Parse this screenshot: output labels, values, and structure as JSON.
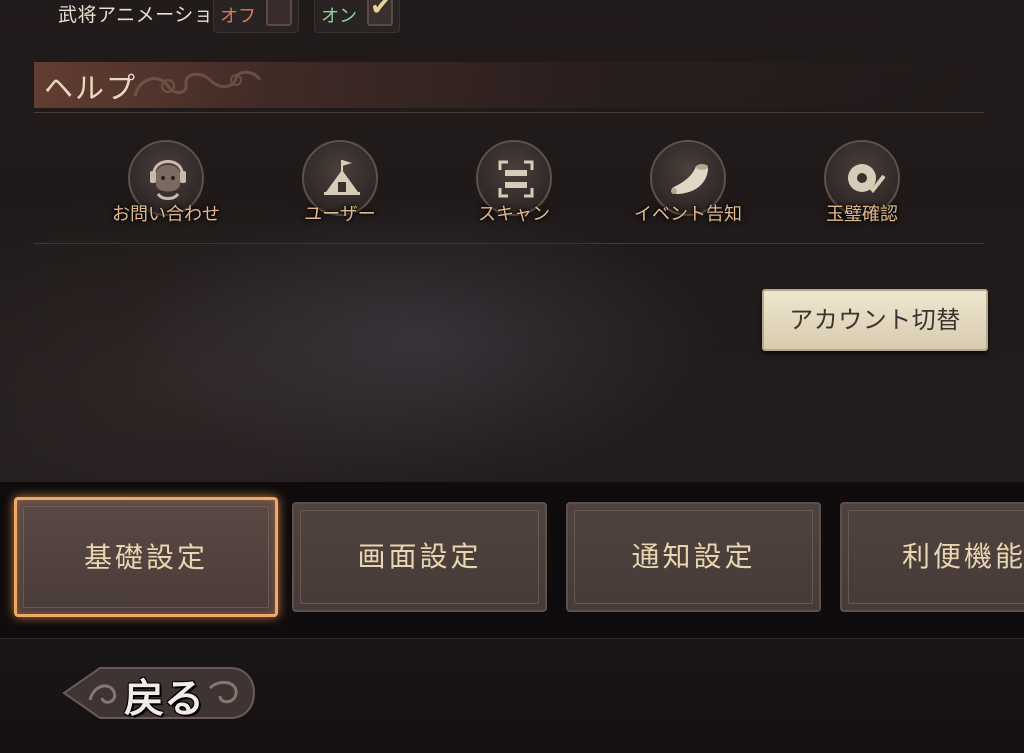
{
  "settings": {
    "general_animation_label": "武将アニメーション",
    "off_label": "オフ",
    "on_label": "オン",
    "selected": "on"
  },
  "help": {
    "title": "ヘルプ",
    "items": [
      {
        "label": "お問い合わせ",
        "icon": "support-agent-icon"
      },
      {
        "label": "ユーザー",
        "icon": "user-tent-icon"
      },
      {
        "label": "スキャン",
        "icon": "scan-icon"
      },
      {
        "label": "イベント告知",
        "icon": "horn-icon"
      },
      {
        "label": "玉璧確認",
        "icon": "jade-disc-check-icon"
      }
    ]
  },
  "account_switch_label": "アカウント切替",
  "tabs": [
    {
      "label": "基礎設定",
      "active": true
    },
    {
      "label": "画面設定",
      "active": false
    },
    {
      "label": "通知設定",
      "active": false
    },
    {
      "label": "利便機能",
      "active": false
    }
  ],
  "back_label": "戻る",
  "colors": {
    "accent_active": "#f0a966",
    "off_text": "#d97a5c",
    "on_text": "#8fd1a3",
    "help_label": "#e0b88a"
  }
}
